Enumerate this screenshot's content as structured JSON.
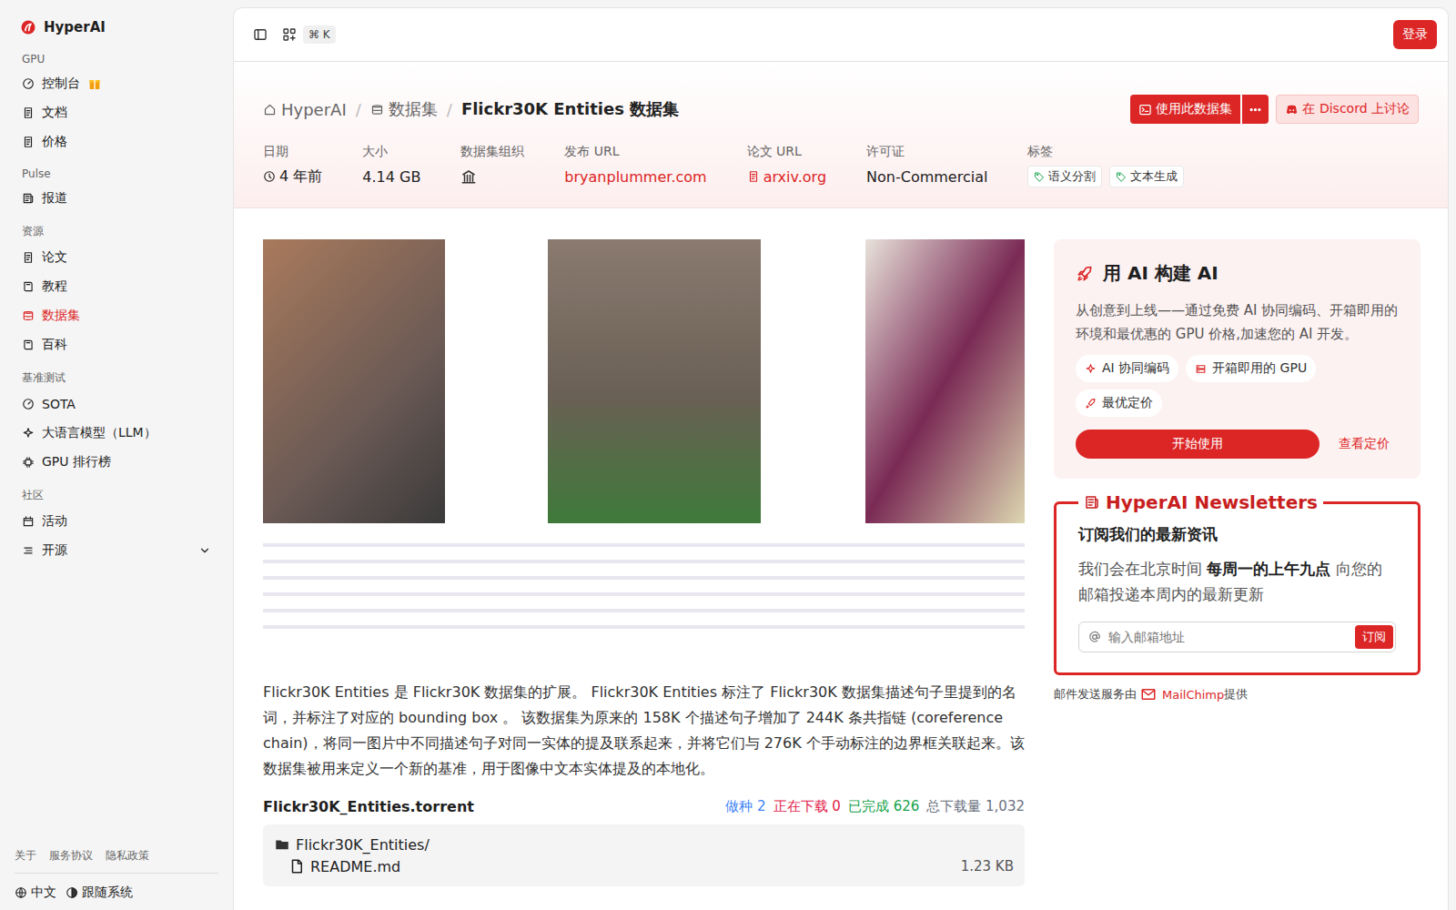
{
  "brand": {
    "name": "HyperAI"
  },
  "sidebar": {
    "sections": [
      {
        "label": "GPU",
        "items": [
          {
            "label": "控制台",
            "selected": false,
            "promo": true,
            "kind": "link"
          },
          {
            "label": "文档",
            "selected": false,
            "promo": false,
            "kind": "link"
          },
          {
            "label": "价格",
            "selected": false,
            "promo": false,
            "kind": "link"
          }
        ]
      },
      {
        "label": "Pulse",
        "items": [
          {
            "label": "报道",
            "selected": false,
            "promo": false,
            "kind": "link"
          }
        ]
      },
      {
        "label": "资源",
        "items": [
          {
            "label": "论文",
            "selected": false,
            "promo": false,
            "kind": "link"
          },
          {
            "label": "教程",
            "selected": false,
            "promo": false,
            "kind": "link"
          },
          {
            "label": "数据集",
            "selected": true,
            "promo": false,
            "kind": "link"
          },
          {
            "label": "百科",
            "selected": false,
            "promo": false,
            "kind": "link"
          }
        ]
      },
      {
        "label": "基准测试",
        "items": [
          {
            "label": "SOTA",
            "selected": false,
            "promo": false,
            "kind": "link"
          },
          {
            "label": "大语言模型（LLM）",
            "selected": false,
            "promo": false,
            "kind": "link"
          },
          {
            "label": "GPU 排行榜",
            "selected": false,
            "promo": false,
            "kind": "link"
          }
        ]
      },
      {
        "label": "社区",
        "items": [
          {
            "label": "活动",
            "selected": false,
            "promo": false,
            "kind": "link"
          },
          {
            "label": "开源",
            "selected": false,
            "promo": false,
            "kind": "group",
            "expanded": false
          }
        ]
      }
    ],
    "footer_links": [
      "关于",
      "服务协议",
      "隐私政策"
    ],
    "language": "中文",
    "theme": "跟随系统"
  },
  "topbar": {
    "shortcut": "⌘ K",
    "login": "登录"
  },
  "breadcrumb": [
    {
      "label": "HyperAI",
      "current": false
    },
    {
      "label": "数据集",
      "current": false
    },
    {
      "label": "Flickr30K Entities 数据集",
      "current": true
    }
  ],
  "actions": {
    "use": "使用此数据集",
    "discord": "在 Discord 上讨论"
  },
  "meta": [
    {
      "label": "日期",
      "value": "4 年前",
      "kind": "time"
    },
    {
      "label": "大小",
      "value": "4.14 GB",
      "kind": "text"
    },
    {
      "label": "数据集组织",
      "value": "",
      "kind": "org"
    },
    {
      "label": "发布 URL",
      "value": "bryanplummer.com",
      "kind": "link"
    },
    {
      "label": "论文 URL",
      "value": "arxiv.org",
      "kind": "paper"
    },
    {
      "label": "许可证",
      "value": "Non-Commercial",
      "kind": "text"
    }
  ],
  "tags": {
    "label": "标签",
    "items": [
      "语义分割",
      "文本生成"
    ]
  },
  "description": "Flickr30K Entities 是 Flickr30K 数据集的扩展。 Flickr30K Entities 标注了 Flickr30K 数据集描述句子里提到的名词，并标注了对应的 bounding box 。 该数据集为原来的 158K 个描述句子增加了 244K 条共指链 (coreference chain)，将同一图片中不同描述句子对同一实体的提及联系起来，并将它们与 276K 个手动标注的边界框关联起来。该数据集被用来定义一个新的基准，用于图像中文本实体提及的本地化。",
  "torrent": {
    "title": "Flickr30K_Entities.torrent",
    "stats": [
      {
        "label": "做种",
        "value": "2",
        "color": "#3b82f6"
      },
      {
        "label": "正在下载",
        "value": "0",
        "color": "#e11d48"
      },
      {
        "label": "已完成",
        "value": "626",
        "color": "#16a34a"
      },
      {
        "label": "总下载量",
        "value": "1,032",
        "color": "#6b7280"
      }
    ],
    "files": [
      {
        "name": "Flickr30K_Entities/",
        "size": "",
        "kind": "folder"
      },
      {
        "name": "README.md",
        "size": "1.23 KB",
        "kind": "file"
      }
    ]
  },
  "promo": {
    "title": "用 AI 构建 AI",
    "text": "从创意到上线——通过免费 AI 协同编码、开箱即用的环境和最优惠的 GPU 价格,加速您的 AI 开发。",
    "chips": [
      "AI 协同编码",
      "开箱即用的 GPU",
      "最优定价"
    ],
    "start": "开始使用",
    "pricing": "查看定价"
  },
  "newsletter": {
    "title": "HyperAI Newsletters",
    "heading": "订阅我们的最新资讯",
    "text": [
      {
        "t": "我们会在北京时间 ",
        "bold": false
      },
      {
        "t": "每周一的上午九点",
        "bold": true
      },
      {
        "t": " 向您的邮箱投递本周内的最新更新",
        "bold": false
      }
    ],
    "placeholder": "输入邮箱地址",
    "button": "订阅",
    "footer": [
      {
        "t": "邮件发送服务由 ",
        "link": false
      },
      {
        "t": "MailChimp",
        "link": true
      },
      {
        "t": " 提供",
        "link": false
      }
    ]
  }
}
